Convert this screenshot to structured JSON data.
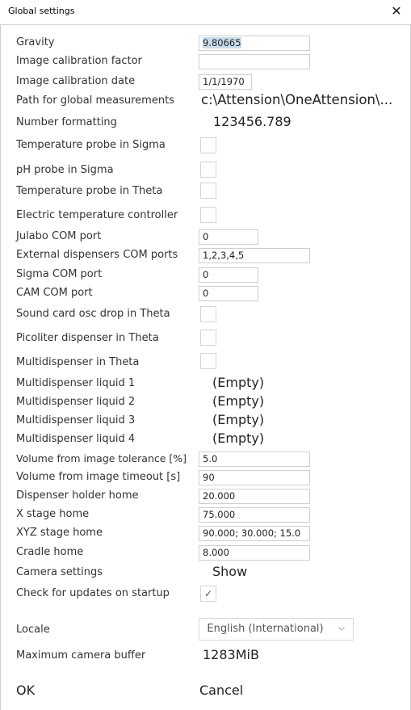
{
  "window": {
    "title": "Global settings",
    "close_icon": "close-icon"
  },
  "fields": {
    "gravity": {
      "label": "Gravity",
      "value": "9.80665"
    },
    "image_calibration_factor": {
      "label": "Image calibration factor",
      "value": ""
    },
    "image_calibration_date": {
      "label": "Image calibration date",
      "value": "1/1/1970"
    },
    "path_global_measurements": {
      "label": "Path for global measurements",
      "value": "c:\\Attension\\OneAttension\\..."
    },
    "number_formatting": {
      "label": "Number formatting",
      "value": "123456.789"
    },
    "temp_probe_sigma": {
      "label": "Temperature probe in Sigma",
      "checked": false
    },
    "ph_probe_sigma": {
      "label": "pH probe in Sigma",
      "checked": false
    },
    "temp_probe_theta": {
      "label": "Temperature probe in Theta",
      "checked": false
    },
    "electric_temp_controller": {
      "label": "Electric temperature controller",
      "checked": false
    },
    "julabo_com_port": {
      "label": "Julabo COM port",
      "value": "0"
    },
    "external_dispensers_com_ports": {
      "label": "External dispensers COM ports",
      "value": "1,2,3,4,5"
    },
    "sigma_com_port": {
      "label": "Sigma COM port",
      "value": "0"
    },
    "cam_com_port": {
      "label": "CAM COM port",
      "value": "0"
    },
    "sound_card_osc_drop": {
      "label": "Sound card osc drop in Theta",
      "checked": false
    },
    "picoliter_dispenser": {
      "label": "Picoliter dispenser in Theta",
      "checked": false
    },
    "multidispenser_theta": {
      "label": "Multidispenser in Theta",
      "checked": false
    },
    "multidispenser_liquid_1": {
      "label": "Multidispenser liquid 1",
      "value": "(Empty)"
    },
    "multidispenser_liquid_2": {
      "label": "Multidispenser liquid 2",
      "value": "(Empty)"
    },
    "multidispenser_liquid_3": {
      "label": "Multidispenser liquid 3",
      "value": "(Empty)"
    },
    "multidispenser_liquid_4": {
      "label": "Multidispenser liquid 4",
      "value": "(Empty)"
    },
    "volume_tolerance": {
      "label": "Volume from image tolerance [%]",
      "value": "5.0"
    },
    "volume_timeout": {
      "label": "Volume from image timeout [s]",
      "value": "90"
    },
    "dispenser_holder_home": {
      "label": "Dispenser holder home",
      "value": "20.000"
    },
    "x_stage_home": {
      "label": "X stage home",
      "value": "75.000"
    },
    "xyz_stage_home": {
      "label": "XYZ stage home",
      "value": "90.000; 30.000; 15.0"
    },
    "cradle_home": {
      "label": "Cradle home",
      "value": "8.000"
    },
    "camera_settings": {
      "label": "Camera settings",
      "value": "Show"
    },
    "check_updates": {
      "label": "Check for updates on startup",
      "checked": true,
      "check_glyph": "✓"
    },
    "locale": {
      "label": "Locale",
      "value": "English (International)"
    },
    "max_camera_buffer": {
      "label": "Maximum camera buffer",
      "value": "1283MiB"
    }
  },
  "buttons": {
    "ok": "OK",
    "cancel": "Cancel"
  },
  "colors": {
    "selection": "#c9dbea",
    "border": "#cfcfcf",
    "text": "#333333"
  }
}
